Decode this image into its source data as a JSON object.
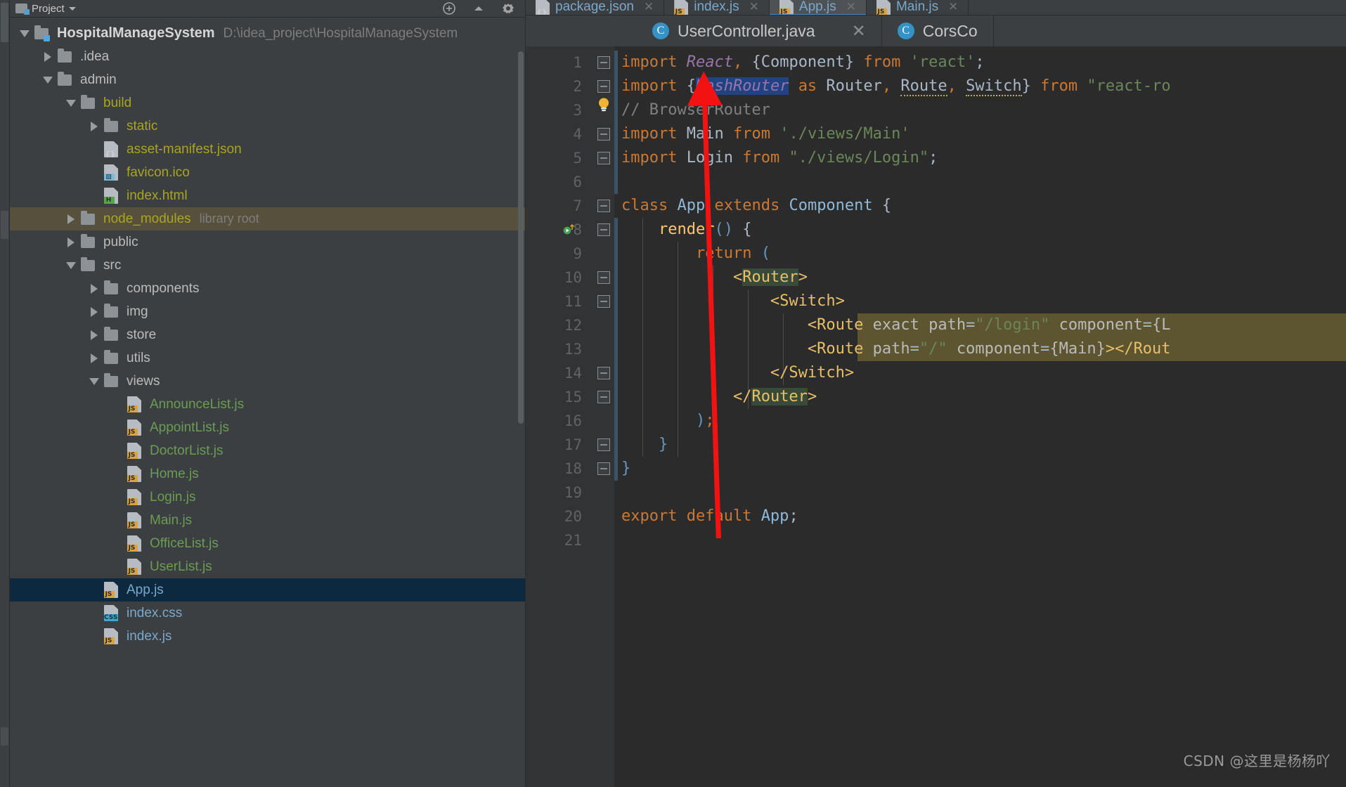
{
  "colors": {
    "panel_bg": "#3c3f41",
    "editor_bg": "#2b2b2b",
    "gutter_bg": "#313335",
    "selected_row": "#0d293f",
    "hovered_row": "#56503c",
    "accent_blue": "#4a88c7",
    "class_icon": "#3592c4",
    "js_badge": "#d9a343",
    "css_badge": "#42a5cf",
    "keyword_orange": "#cc7832",
    "string_green": "#6a8759",
    "tag_yellow": "#e8bf6a",
    "selection_blue": "#214283",
    "arrow_red": "#f21212",
    "highlight_olive": "#5d5430",
    "highlight_green": "#3a4a38"
  },
  "project_panel": {
    "header": {
      "title": "Project",
      "caret_icon": "chevron-down-icon",
      "project_icon": "project-window-icon",
      "right_icons": [
        "collapse-all-icon",
        "settings-gear-icon"
      ]
    },
    "tree": [
      {
        "indent": 0,
        "twisty": "down",
        "icon": "folder-module",
        "label": "HospitalManageSystem",
        "style": "proj",
        "sub": "D:\\idea_project\\HospitalManageSystem",
        "state": "normal"
      },
      {
        "indent": 1,
        "twisty": "right",
        "icon": "folder",
        "label": ".idea",
        "style": "dir",
        "sub": "",
        "state": "normal"
      },
      {
        "indent": 1,
        "twisty": "down",
        "icon": "folder",
        "label": "admin",
        "style": "dir",
        "sub": "",
        "state": "normal"
      },
      {
        "indent": 2,
        "twisty": "down",
        "icon": "folder",
        "label": "build",
        "style": "yellow",
        "sub": "",
        "state": "normal"
      },
      {
        "indent": 3,
        "twisty": "right",
        "icon": "folder",
        "label": "static",
        "style": "yellow",
        "sub": "",
        "state": "normal"
      },
      {
        "indent": 3,
        "twisty": "none",
        "icon": "file-json",
        "label": "asset-manifest.json",
        "style": "yellow",
        "sub": "",
        "state": "normal"
      },
      {
        "indent": 3,
        "twisty": "none",
        "icon": "file-image",
        "label": "favicon.ico",
        "style": "yellow",
        "sub": "",
        "state": "normal"
      },
      {
        "indent": 3,
        "twisty": "none",
        "icon": "file-html",
        "label": "index.html",
        "style": "yellow",
        "sub": "",
        "state": "normal"
      },
      {
        "indent": 2,
        "twisty": "right",
        "icon": "folder",
        "label": "node_modules",
        "style": "yellow",
        "sub": "library root",
        "state": "hovered"
      },
      {
        "indent": 2,
        "twisty": "right",
        "icon": "folder",
        "label": "public",
        "style": "dir",
        "sub": "",
        "state": "normal"
      },
      {
        "indent": 2,
        "twisty": "down",
        "icon": "folder",
        "label": "src",
        "style": "dir",
        "sub": "",
        "state": "normal"
      },
      {
        "indent": 3,
        "twisty": "right",
        "icon": "folder",
        "label": "components",
        "style": "dir",
        "sub": "",
        "state": "normal"
      },
      {
        "indent": 3,
        "twisty": "right",
        "icon": "folder",
        "label": "img",
        "style": "dir",
        "sub": "",
        "state": "normal"
      },
      {
        "indent": 3,
        "twisty": "right",
        "icon": "folder",
        "label": "store",
        "style": "dir",
        "sub": "",
        "state": "normal"
      },
      {
        "indent": 3,
        "twisty": "right",
        "icon": "folder",
        "label": "utils",
        "style": "dir",
        "sub": "",
        "state": "normal"
      },
      {
        "indent": 3,
        "twisty": "down",
        "icon": "folder",
        "label": "views",
        "style": "dir",
        "sub": "",
        "state": "normal"
      },
      {
        "indent": 4,
        "twisty": "none",
        "icon": "file-js",
        "label": "AnnounceList.js",
        "style": "green",
        "sub": "",
        "state": "normal"
      },
      {
        "indent": 4,
        "twisty": "none",
        "icon": "file-js",
        "label": "AppointList.js",
        "style": "green",
        "sub": "",
        "state": "normal"
      },
      {
        "indent": 4,
        "twisty": "none",
        "icon": "file-js",
        "label": "DoctorList.js",
        "style": "green",
        "sub": "",
        "state": "normal"
      },
      {
        "indent": 4,
        "twisty": "none",
        "icon": "file-js",
        "label": "Home.js",
        "style": "green",
        "sub": "",
        "state": "normal"
      },
      {
        "indent": 4,
        "twisty": "none",
        "icon": "file-js",
        "label": "Login.js",
        "style": "green",
        "sub": "",
        "state": "normal"
      },
      {
        "indent": 4,
        "twisty": "none",
        "icon": "file-js",
        "label": "Main.js",
        "style": "green",
        "sub": "",
        "state": "normal"
      },
      {
        "indent": 4,
        "twisty": "none",
        "icon": "file-js",
        "label": "OfficeList.js",
        "style": "green",
        "sub": "",
        "state": "normal"
      },
      {
        "indent": 4,
        "twisty": "none",
        "icon": "file-js",
        "label": "UserList.js",
        "style": "green",
        "sub": "",
        "state": "normal"
      },
      {
        "indent": 3,
        "twisty": "none",
        "icon": "file-js",
        "label": "App.js",
        "style": "blue",
        "sub": "",
        "state": "selected"
      },
      {
        "indent": 3,
        "twisty": "none",
        "icon": "file-css",
        "label": "index.css",
        "style": "blue",
        "sub": "",
        "state": "normal"
      },
      {
        "indent": 3,
        "twisty": "none",
        "icon": "file-js",
        "label": "index.js",
        "style": "blue",
        "sub": "",
        "state": "normal"
      }
    ]
  },
  "editor": {
    "tab_row_top": [
      {
        "label": "package.json",
        "icon": "json-file-icon",
        "active": false,
        "closable": true
      },
      {
        "label": "index.js",
        "icon": "js-file-icon",
        "active": false,
        "closable": true
      },
      {
        "label": "App.js",
        "icon": "js-file-icon",
        "active": true,
        "closable": true
      },
      {
        "label": "Main.js",
        "icon": "js-file-icon",
        "active": false,
        "closable": true
      }
    ],
    "tab_row_second": [
      {
        "label": "UserController.java",
        "icon": "java-class-icon",
        "closable": true
      },
      {
        "label": "CorsCo",
        "icon": "java-class-icon",
        "closable": false
      }
    ],
    "line_numbers": [
      "1",
      "2",
      "3",
      "4",
      "5",
      "6",
      "7",
      "8",
      "9",
      "10",
      "11",
      "12",
      "13",
      "14",
      "15",
      "16",
      "17",
      "18",
      "19",
      "20",
      "21"
    ],
    "gutter_icons": {
      "line_1": "intention-bulb-icon",
      "line_8": "run-method-icon"
    },
    "code_lines": [
      {
        "n": 1,
        "fold": true,
        "text": "import React, {Component} from 'react';"
      },
      {
        "n": 2,
        "fold": true,
        "text": "import {HashRouter as Router, Route, Switch} from \"react-ro"
      },
      {
        "n": 3,
        "fold": false,
        "text": "// BrowserRouter"
      },
      {
        "n": 4,
        "fold": true,
        "text": "import Main from './views/Main'"
      },
      {
        "n": 5,
        "fold": true,
        "text": "import Login from \"./views/Login\";"
      },
      {
        "n": 6,
        "fold": false,
        "text": ""
      },
      {
        "n": 7,
        "fold": true,
        "text": "class App extends Component {"
      },
      {
        "n": 8,
        "fold": true,
        "text": "    render() {"
      },
      {
        "n": 9,
        "fold": false,
        "text": "        return ("
      },
      {
        "n": 10,
        "fold": true,
        "text": "            <Router>"
      },
      {
        "n": 11,
        "fold": true,
        "text": "                <Switch>"
      },
      {
        "n": 12,
        "fold": false,
        "text": "                    <Route exact path=\"/login\" component={L"
      },
      {
        "n": 13,
        "fold": false,
        "text": "                    <Route path=\"/\" component={Main}></Rout"
      },
      {
        "n": 14,
        "fold": true,
        "text": "                </Switch>"
      },
      {
        "n": 15,
        "fold": true,
        "text": "            </Router>"
      },
      {
        "n": 16,
        "fold": false,
        "text": "        );"
      },
      {
        "n": 17,
        "fold": true,
        "text": "    }"
      },
      {
        "n": 18,
        "fold": true,
        "text": "}"
      },
      {
        "n": 19,
        "fold": false,
        "text": ""
      },
      {
        "n": 20,
        "fold": false,
        "text": "export default App;"
      },
      {
        "n": 21,
        "fold": false,
        "text": ""
      }
    ],
    "selection": {
      "text": "HashRouter",
      "line": 2
    },
    "annotation": {
      "type": "red-arrow",
      "points_to": "HashRouter"
    }
  },
  "watermark": "CSDN @这里是杨杨吖"
}
